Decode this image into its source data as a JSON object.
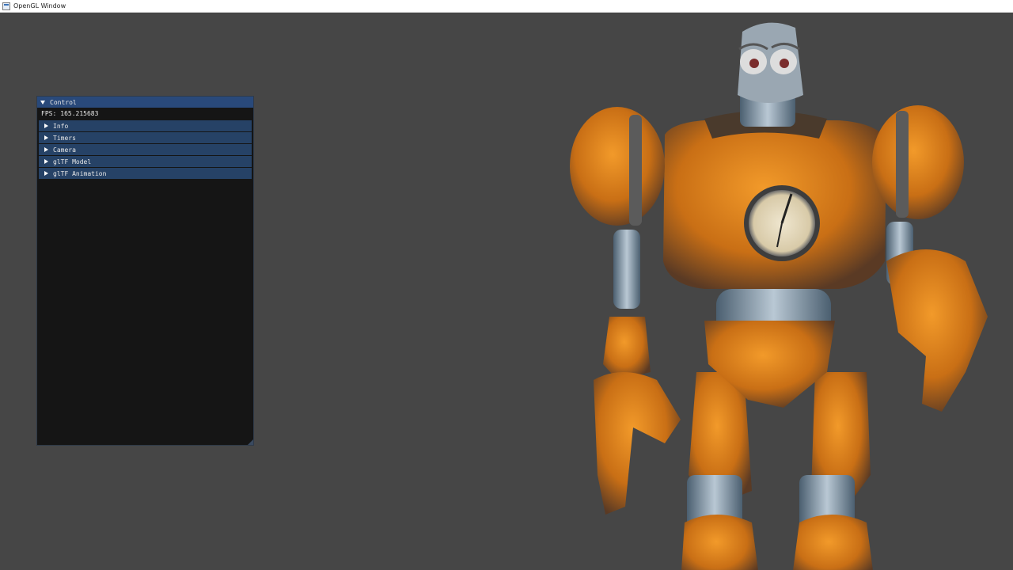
{
  "window": {
    "title": "OpenGL Window"
  },
  "control": {
    "title": "Control",
    "fps_label": "FPS:",
    "fps_value": "165.215683",
    "sections": [
      {
        "label": "Info"
      },
      {
        "label": "Timers"
      },
      {
        "label": "Camera"
      },
      {
        "label": "glTF Model"
      },
      {
        "label": "glTF Animation"
      }
    ]
  },
  "colors": {
    "background": "#464646",
    "panel": "#151515",
    "title_active": "#29497a",
    "header": "#264266",
    "robot_orange": "#d9801c",
    "robot_metal": "#8fa3b4"
  }
}
